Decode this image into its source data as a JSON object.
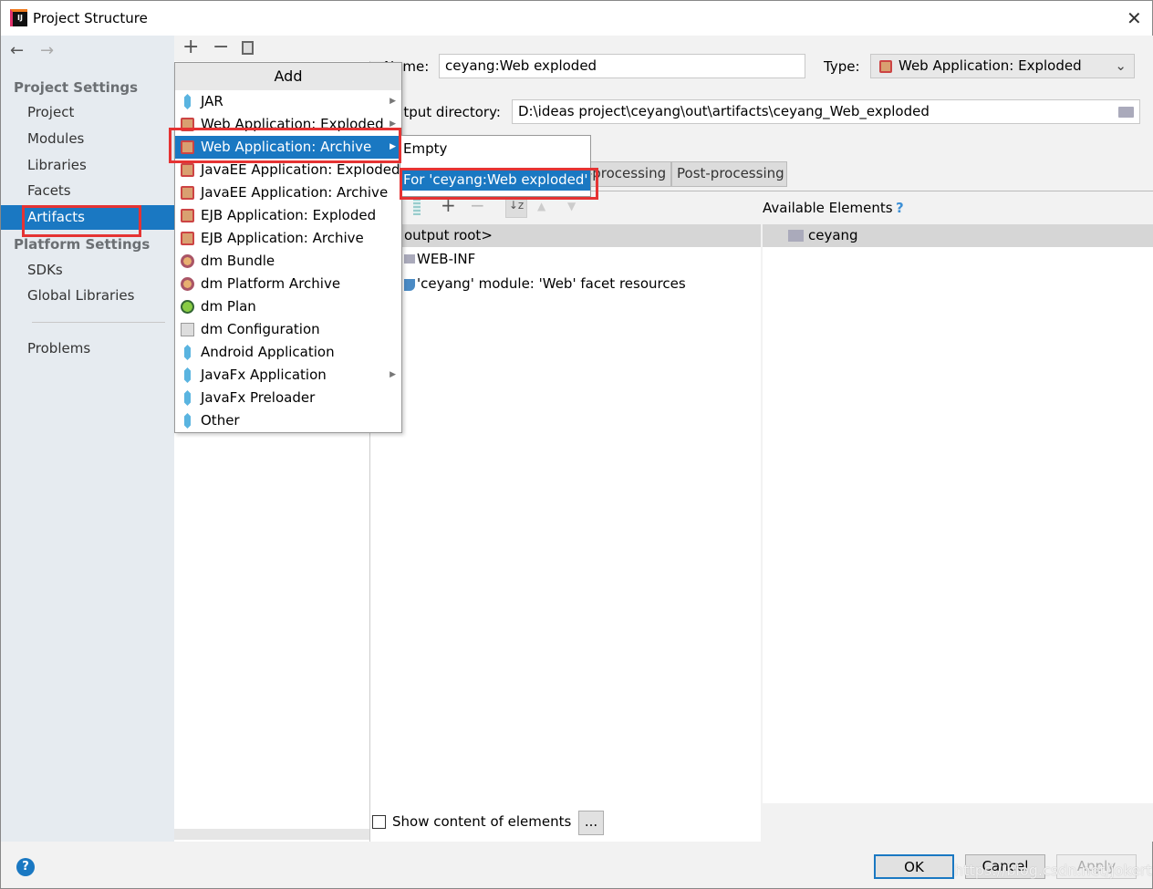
{
  "window": {
    "title": "Project Structure"
  },
  "sidebar": {
    "project_settings": "Project Settings",
    "items": [
      "Project",
      "Modules",
      "Libraries",
      "Facets",
      "Artifacts"
    ],
    "selected": "Artifacts",
    "platform_settings": "Platform Settings",
    "platform_items": [
      "SDKs",
      "Global Libraries"
    ],
    "problems": "Problems"
  },
  "add_menu": {
    "title": "Add",
    "items": [
      {
        "label": "JAR",
        "icon": "jar-icon",
        "submenu": true
      },
      {
        "label": "Web Application: Exploded",
        "icon": "web-app-icon",
        "submenu": true
      },
      {
        "label": "Web Application: Archive",
        "icon": "web-app-icon",
        "submenu": true,
        "selected": true
      },
      {
        "label": "JavaEE Application: Exploded",
        "icon": "javaee-icon"
      },
      {
        "label": "JavaEE Application: Archive",
        "icon": "javaee-icon"
      },
      {
        "label": "EJB Application: Exploded",
        "icon": "ejb-icon"
      },
      {
        "label": "EJB Application: Archive",
        "icon": "ejb-icon"
      },
      {
        "label": "dm Bundle",
        "icon": "bundle-icon"
      },
      {
        "label": "dm Platform Archive",
        "icon": "bundle-icon"
      },
      {
        "label": "dm Plan",
        "icon": "plan-icon"
      },
      {
        "label": "dm Configuration",
        "icon": "config-icon"
      },
      {
        "label": "Android Application",
        "icon": "jar-icon"
      },
      {
        "label": "JavaFx Application",
        "icon": "jar-icon",
        "submenu": true
      },
      {
        "label": "JavaFx Preloader",
        "icon": "jar-icon"
      },
      {
        "label": "Other",
        "icon": "jar-icon"
      }
    ]
  },
  "submenu": {
    "items": [
      "Empty",
      "For 'ceyang:Web exploded'"
    ],
    "selected": "For 'ceyang:Web exploded'"
  },
  "artifact": {
    "name_label": "Name:",
    "name_value": "ceyang:Web exploded",
    "type_label": "Type:",
    "type_value": "Web Application: Exploded",
    "output_label": "Output directory:",
    "output_value": "D:\\ideas project\\ceyang\\out\\artifacts\\ceyang_Web_exploded",
    "tabs": [
      "Pre-processing",
      "Post-processing"
    ],
    "tab_pre_visible": "-processing",
    "tree": [
      "<output root>",
      "WEB-INF",
      "'ceyang' module: 'Web' facet resources"
    ],
    "tree_root_visible": "output root>",
    "available_label": "Available Elements",
    "help": "?",
    "available": [
      "ceyang"
    ],
    "show_content": "Show content of elements",
    "ellipsis": "..."
  },
  "footer": {
    "ok": "OK",
    "cancel": "Cancel",
    "apply": "Apply",
    "watermark": "https://blog.csdn.net/jokertiger"
  },
  "colors": {
    "selection": "#1a78c2",
    "highlight_box": "#e53333"
  }
}
